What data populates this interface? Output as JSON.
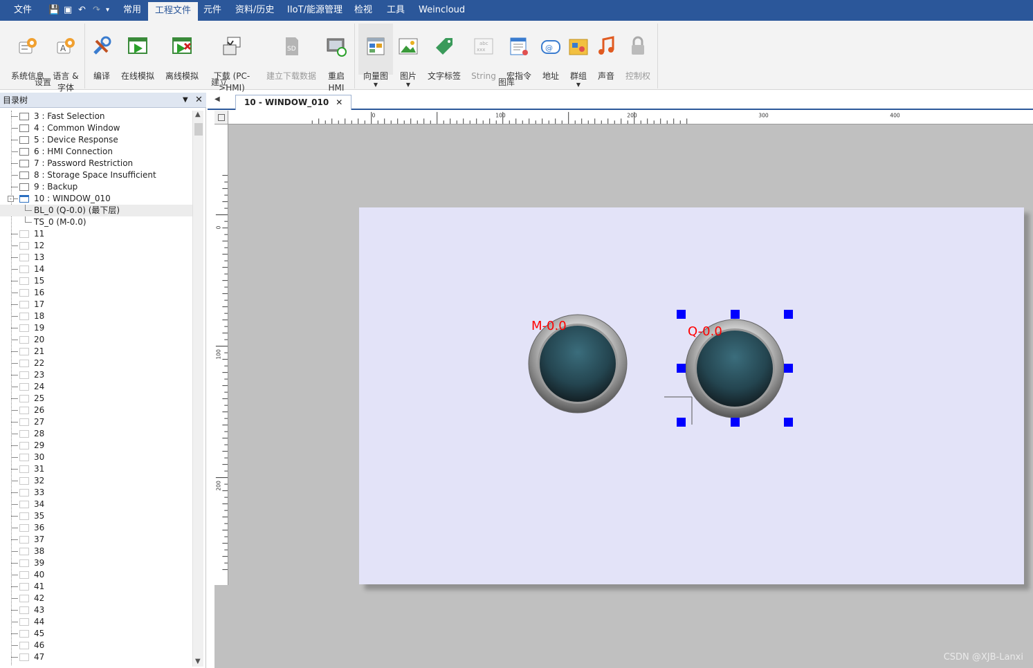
{
  "menubar": {
    "items": [
      "文件",
      "常用",
      "工程文件",
      "元件",
      "资料/历史",
      "IIoT/能源管理",
      "检视",
      "工具",
      "Weincloud"
    ],
    "active": "工程文件"
  },
  "ribbon": {
    "groups": {
      "settings": "设置",
      "build": "建立",
      "library": "图库"
    },
    "buttons": {
      "system_info": "系统信息",
      "language_font": "语言 &\n字体",
      "compile": "编译",
      "online_sim": "在线模拟",
      "offline_sim": "离线模拟",
      "download": "下载 (PC-\n>HMI)",
      "build_download_data": "建立下载数据",
      "restart_hmi": "重启\nHMI",
      "vector_graph": "向量图",
      "picture": "图片",
      "text_tag": "文字标签",
      "string": "String",
      "macro": "宏指令",
      "address": "地址",
      "group": "群组",
      "sound": "声音",
      "control_right": "控制权"
    },
    "sd_label": "SD"
  },
  "directory": {
    "title": "目录树",
    "items": [
      "3 : Fast Selection",
      "4 : Common Window",
      "5 : Device Response",
      "6 : HMI Connection",
      "7 : Password Restriction",
      "8 : Storage Space Insufficient",
      "9 : Backup",
      "10 : WINDOW_010",
      "BL_0 (Q-0.0) (最下层)",
      "TS_0 (M-0.0)",
      "11",
      "12",
      "13",
      "14",
      "15",
      "16",
      "17",
      "18",
      "19",
      "20",
      "21",
      "22",
      "23",
      "24",
      "25",
      "26",
      "27",
      "28",
      "29",
      "30",
      "31",
      "32",
      "33",
      "34",
      "35",
      "36",
      "37",
      "38",
      "39",
      "40",
      "41",
      "42",
      "43",
      "44",
      "45",
      "46",
      "47"
    ]
  },
  "editor": {
    "tab_label": "10 - WINDOW_010",
    "ruler_h": [
      "0",
      "100",
      "200",
      "300",
      "400"
    ],
    "ruler_v": [
      "0",
      "100",
      "200"
    ],
    "lamp_left_label": "M-0.0",
    "lamp_right_label": "Q-0.0"
  },
  "watermark": "CSDN @XJB-Lanxi",
  "colors": {
    "menubar": "#2b579a",
    "canvas": "#e3e3f8",
    "label": "#ff0000",
    "handle": "#0000ff"
  }
}
